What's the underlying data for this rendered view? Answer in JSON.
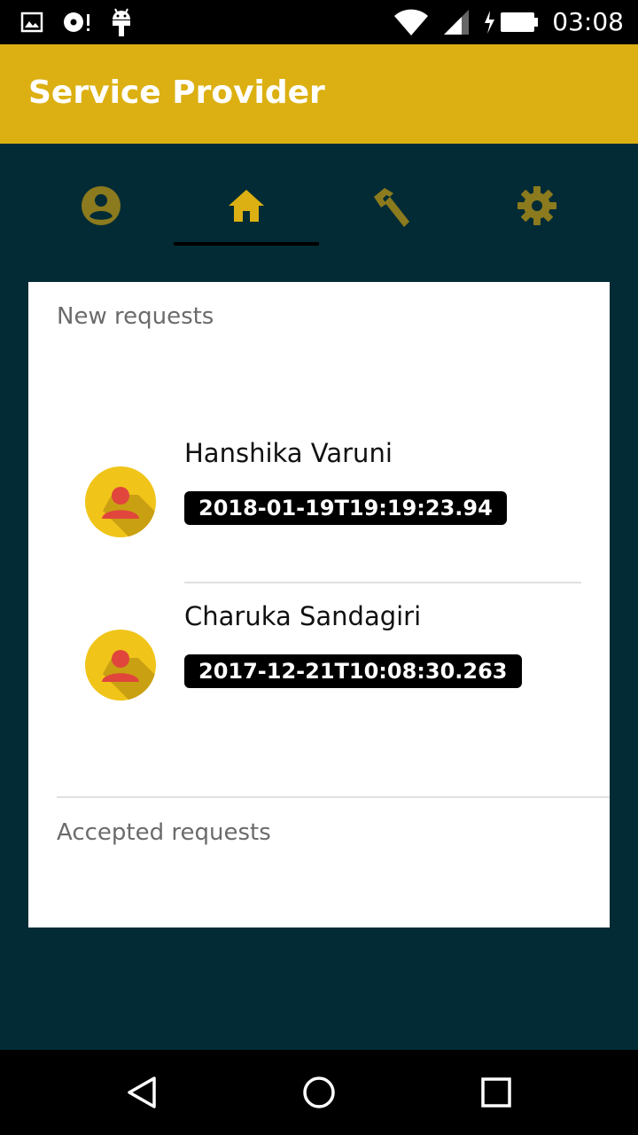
{
  "status_bar": {
    "time": "03:08",
    "icons": [
      "image-notification-icon",
      "media-notification-icon",
      "android-debug-icon",
      "wifi-icon",
      "signal-icon",
      "battery-charging-icon"
    ]
  },
  "app_bar": {
    "title": "Service Provider"
  },
  "tabs": [
    {
      "icon": "account-circle-icon",
      "selected": false
    },
    {
      "icon": "home-icon",
      "selected": true
    },
    {
      "icon": "hammer-icon",
      "selected": false
    },
    {
      "icon": "gear-icon",
      "selected": false
    }
  ],
  "card": {
    "new_requests_label": "New requests",
    "accepted_requests_label": "Accepted requests",
    "requests": [
      {
        "name": "Hanshika Varuni",
        "timestamp": "2018-01-19T19:19:23.94"
      },
      {
        "name": "Charuka Sandagiri",
        "timestamp": "2017-12-21T10:08:30.263"
      }
    ]
  },
  "nav_bar": {
    "buttons": [
      "back-icon",
      "home-circle-icon",
      "recents-icon"
    ]
  },
  "colors": {
    "app_bar": "#dcb012",
    "background": "#022b35",
    "tab_icon_inactive": "#8b7a1e",
    "tab_icon_active": "#dcb012",
    "avatar_bg": "#f0c419",
    "avatar_figure": "#e0463c"
  }
}
